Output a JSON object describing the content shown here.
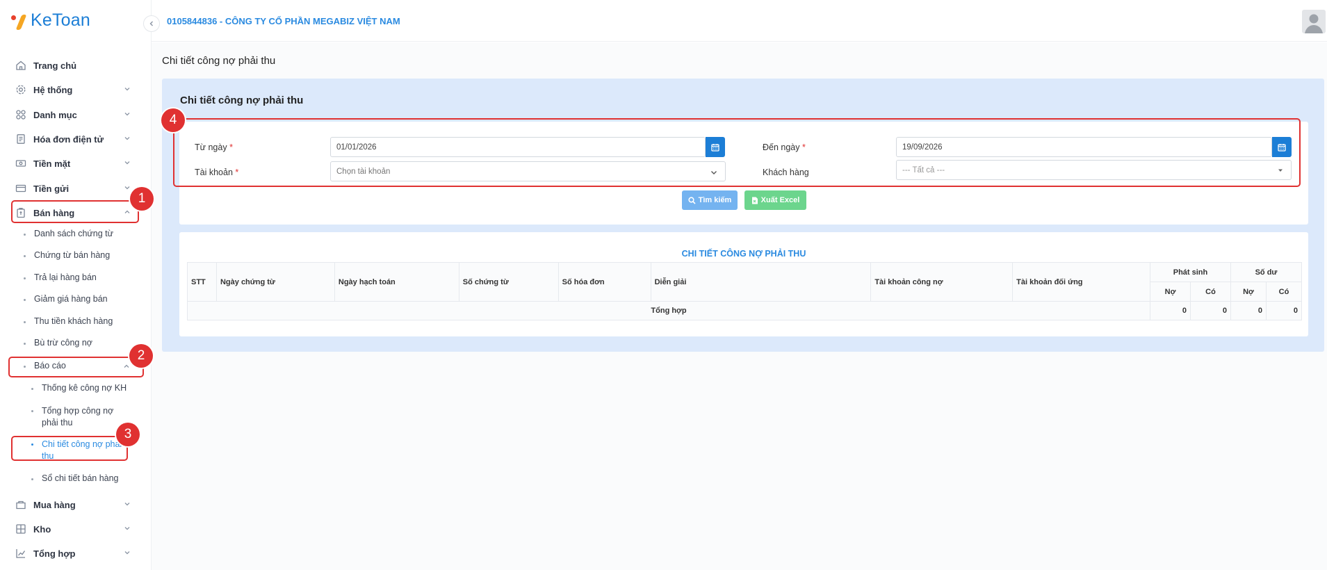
{
  "brand": {
    "logo_text": "KeToan"
  },
  "header": {
    "company": "0105844836 - CÔNG TY CỔ PHẦN MEGABIZ VIỆT NAM"
  },
  "sidebar": {
    "items": [
      {
        "label": "Trang chủ",
        "icon": "home-icon"
      },
      {
        "label": "Hệ thống",
        "icon": "gear-icon"
      },
      {
        "label": "Danh mục",
        "icon": "grid-icon"
      },
      {
        "label": "Hóa đơn điện tử",
        "icon": "invoice-icon"
      },
      {
        "label": "Tiền mặt",
        "icon": "cash-icon"
      },
      {
        "label": "Tiền gửi",
        "icon": "card-icon"
      },
      {
        "label": "Bán hàng",
        "icon": "sales-icon"
      }
    ],
    "sales_sub": [
      "Danh sách chứng từ",
      "Chứng từ bán hàng",
      "Trả lại hàng bán",
      "Giảm giá hàng bán",
      "Thu tiền khách hàng",
      "Bù trừ công nợ",
      "Báo cáo"
    ],
    "report_sub": [
      "Thống kê công nợ KH",
      "Tổng hợp công nợ phải thu",
      "Chi tiết công nợ phải thu",
      "Sổ chi tiết bán hàng"
    ],
    "bottom_items": [
      {
        "label": "Mua hàng",
        "icon": "purchase-icon"
      },
      {
        "label": "Kho",
        "icon": "warehouse-icon"
      },
      {
        "label": "Tổng hợp",
        "icon": "chart-icon"
      }
    ]
  },
  "page": {
    "title": "Chi tiết công nợ phải thu",
    "panel_title": "Chi tiết công nợ phải thu"
  },
  "filters": {
    "from_label": "Từ ngày",
    "from_value": "01/01/2026",
    "to_label": "Đến ngày",
    "to_value": "19/09/2026",
    "account_label": "Tài khoản",
    "account_placeholder": "Chọn tài khoản",
    "customer_label": "Khách hàng",
    "customer_value": "--- Tất cả ---",
    "required_mark": "*",
    "search_btn": "Tìm kiếm",
    "excel_btn": "Xuất Excel"
  },
  "table": {
    "title": "CHI TIẾT CÔNG NỢ PHẢI THU",
    "headers": [
      "STT",
      "Ngày chứng từ",
      "Ngày hạch toán",
      "Số chứng từ",
      "Số hóa đơn",
      "Diễn giải",
      "Tài khoản công nợ",
      "Tài khoản đối ứng"
    ],
    "group_headers": [
      "Phát sinh",
      "Số dư"
    ],
    "sub_headers": [
      "Nợ",
      "Có",
      "Nợ",
      "Có"
    ],
    "total_label": "Tổng hợp",
    "totals": [
      "0",
      "0",
      "0",
      "0"
    ]
  },
  "annotations": [
    "1",
    "2",
    "3",
    "4"
  ],
  "colors": {
    "primary": "#1c7ed6",
    "accent": "#2a8ae0",
    "annotation": "#e03131"
  }
}
